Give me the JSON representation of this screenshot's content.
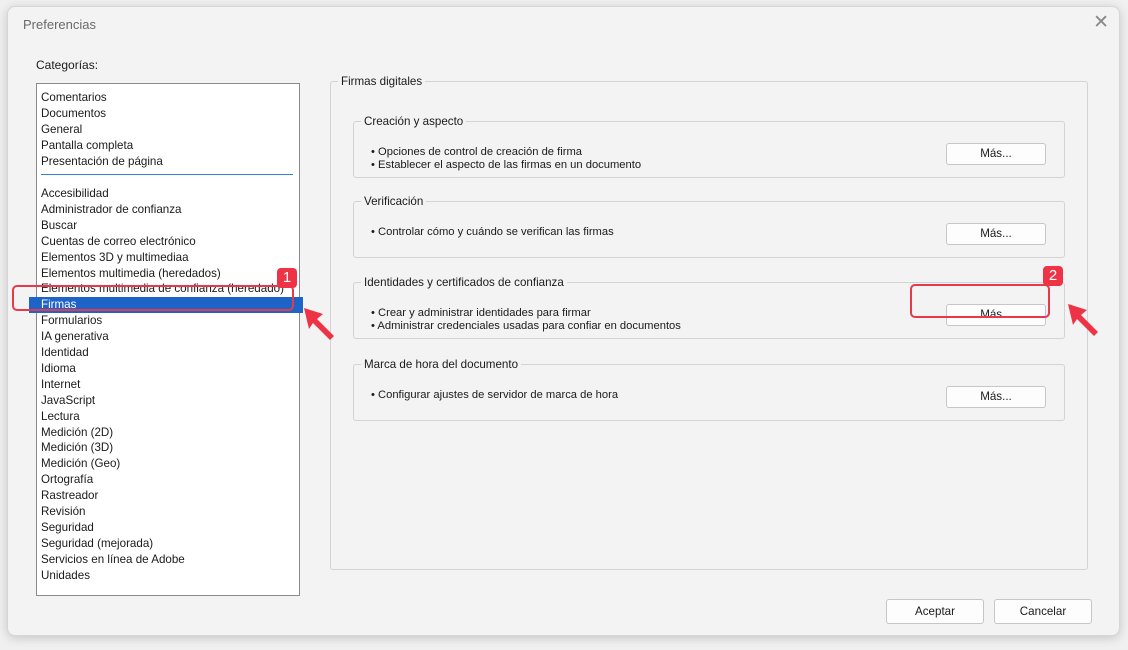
{
  "dialog": {
    "title": "Preferencias",
    "close_glyph": "✕"
  },
  "categories": {
    "label": "Categorías:",
    "top_items": [
      {
        "label": "Comentarios"
      },
      {
        "label": "Documentos"
      },
      {
        "label": "General"
      },
      {
        "label": "Pantalla completa"
      },
      {
        "label": "Presentación de página"
      }
    ],
    "items": [
      {
        "label": "Accesibilidad"
      },
      {
        "label": "Administrador de confianza"
      },
      {
        "label": "Buscar"
      },
      {
        "label": "Cuentas de correo electrónico"
      },
      {
        "label": "Elementos 3D y multimediaa"
      },
      {
        "label": "Elementos multimedia (heredados)"
      },
      {
        "label": "Elementos multimedia de confianza (heredado)"
      },
      {
        "label": "Firmas",
        "selected": true
      },
      {
        "label": "Formularios"
      },
      {
        "label": "IA generativa"
      },
      {
        "label": "Identidad"
      },
      {
        "label": "Idioma"
      },
      {
        "label": "Internet"
      },
      {
        "label": "JavaScript"
      },
      {
        "label": "Lectura"
      },
      {
        "label": "Medición (2D)"
      },
      {
        "label": "Medición (3D)"
      },
      {
        "label": "Medición (Geo)"
      },
      {
        "label": "Ortografía"
      },
      {
        "label": "Rastreador"
      },
      {
        "label": "Revisión"
      },
      {
        "label": "Seguridad"
      },
      {
        "label": "Seguridad (mejorada)"
      },
      {
        "label": "Servicios en línea de Adobe"
      },
      {
        "label": "Unidades"
      }
    ]
  },
  "panel": {
    "title": "Firmas digitales",
    "sections": [
      {
        "title": "Creación y aspecto",
        "bullets": [
          "• Opciones de control de creación de firma",
          "• Establecer el aspecto de las firmas en un documento"
        ],
        "button": "Más..."
      },
      {
        "title": "Verificación",
        "bullets": [
          "• Controlar cómo y cuándo se verifican las firmas"
        ],
        "button": "Más..."
      },
      {
        "title": "Identidades y certificados de confianza",
        "bullets": [
          "• Crear y administrar identidades para firmar",
          "• Administrar credenciales usadas para confiar en documentos"
        ],
        "button": "Más..."
      },
      {
        "title": "Marca de hora del documento",
        "bullets": [
          "• Configurar ajustes de servidor de marca de hora"
        ],
        "button": "Más..."
      }
    ]
  },
  "footer": {
    "ok_label": "Aceptar",
    "cancel_label": "Cancelar"
  },
  "annotations": {
    "badge1": "1",
    "badge2": "2",
    "color": "#ef3346"
  },
  "colors": {
    "selection": "#1e64c8",
    "separator": "#3a7fc9"
  }
}
